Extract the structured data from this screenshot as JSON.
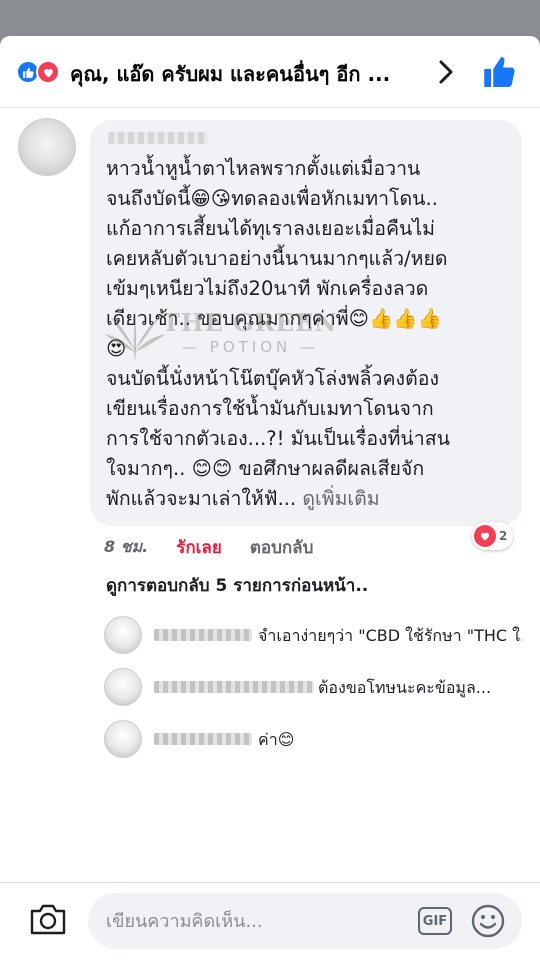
{
  "header": {
    "title": "คุณ, แอ๊ด ครับผม และคนอื่นๆ อีก ...",
    "react_like_icon": "thumbs-up-icon",
    "react_love_icon": "heart-icon"
  },
  "comment": {
    "lines": [
      "หาวน้ำหูน้ำตาไหลพรากตั้งแต่เมื่อวาน",
      "จนถึงบัดนี้😁😘ทดลองเพื่อหักเมทาโดน..",
      "แก้อาการเสี้ยนได้ทุเราลงเยอะเมื่อคืนไม่",
      "เคยหลับตัวเบาอย่างนี้นานมากๆแล้ว/หยด",
      "เข้มๆเหนียวไม่ถึง20นาที พักเครื่องลวด",
      "เดียวเช้า.. ขอบคุณมากๆค่าพี่😊👍👍👍",
      "😍",
      "จนบัดนี้นั่งหน้าโน๊ตบุ๊คหัวโล่งพลิ้วคงต้อง",
      "เขียนเรื่องการใช้น้ำมันกับเมทาโดนจาก",
      "การใช้จากตัวเอง...?! มันเป็นเรื่องที่น่าสน",
      "ใจมากๆ.. 😊😊 ขอศึกษาผลดีผลเสียจัก"
    ],
    "last_line": "พักแล้วจะมาเล่าให้ฟั...",
    "see_more": "ดูเพิ่มเติม"
  },
  "watermark": {
    "title": "THE GREEN",
    "subtitle": "— POTION —"
  },
  "actions": {
    "time": "8 ชม.",
    "love": "รักเลย",
    "reply": "ตอบกลับ",
    "reaction_count": "2"
  },
  "previous_replies_label": "ดูการตอบกลับ 5 รายการก่อนหน้า..",
  "replies": [
    {
      "text": "จำเอาง่ายๆว่า \"CBD ใช้รักษา \"THC ใ..."
    },
    {
      "text": "ต้องขอโทษนะคะข้อมูล..."
    },
    {
      "text": "ค่า😊"
    }
  ],
  "composer": {
    "placeholder": "เขียนความคิดเห็น...",
    "gif_label": "GIF",
    "camera_icon": "camera-icon",
    "emoji_icon": "smiley-icon"
  },
  "colors": {
    "facebook_blue": "#1877f2",
    "love_red": "#f33e58",
    "bubble_gray": "#f0f2f5",
    "secondary_text": "#65676b"
  }
}
